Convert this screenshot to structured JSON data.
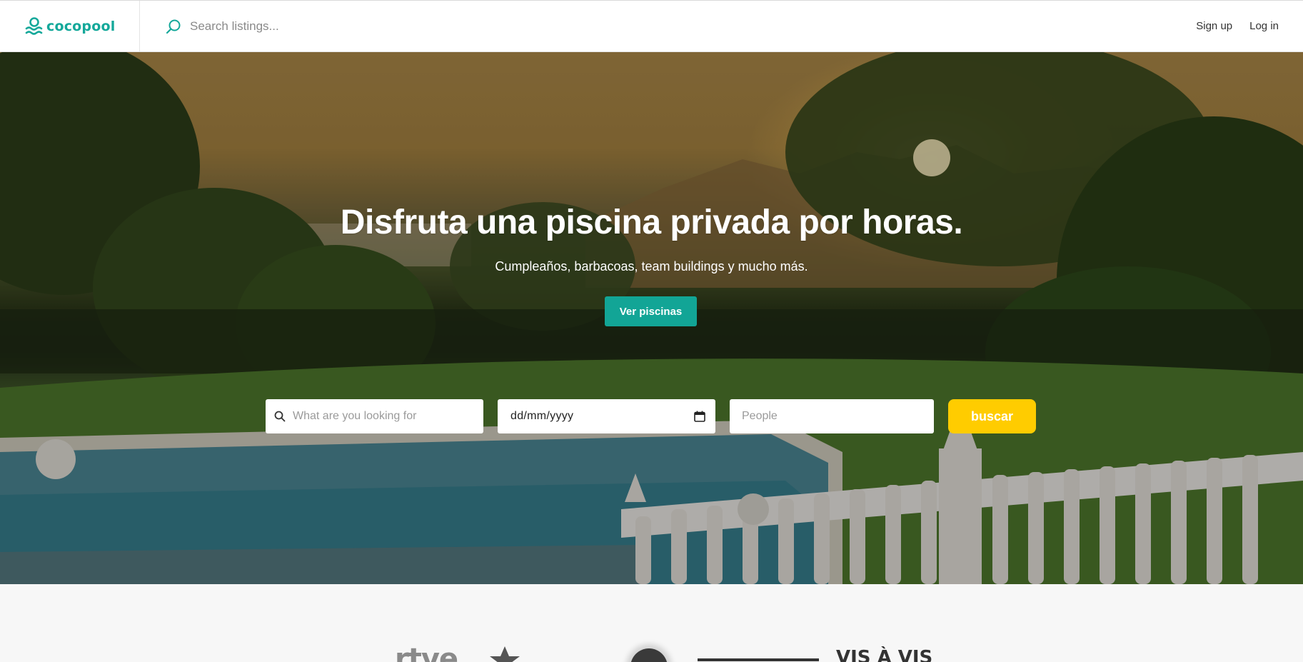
{
  "app": {
    "name": "cocopool",
    "brand_color": "#14a89a",
    "accent_color": "#ffcc00"
  },
  "header": {
    "search_placeholder": "Search listings...",
    "signup_label": "Sign up",
    "login_label": "Log in"
  },
  "hero": {
    "title": "Disfruta una piscina privada por horas.",
    "subtitle": "Cumpleaños, barbacoas, team buildings y mucho más.",
    "cta_label": "Ver piscinas"
  },
  "search_form": {
    "what_placeholder": "What are you looking for",
    "date_value": "dd/mm/yyyy",
    "people_placeholder": "People",
    "submit_label": "buscar"
  },
  "press": {
    "logos": [
      "rtve",
      "VIS À VIS"
    ]
  },
  "icons": [
    "cocopool-logo-icon",
    "search-icon",
    "magnifier-icon",
    "calendar-icon"
  ]
}
